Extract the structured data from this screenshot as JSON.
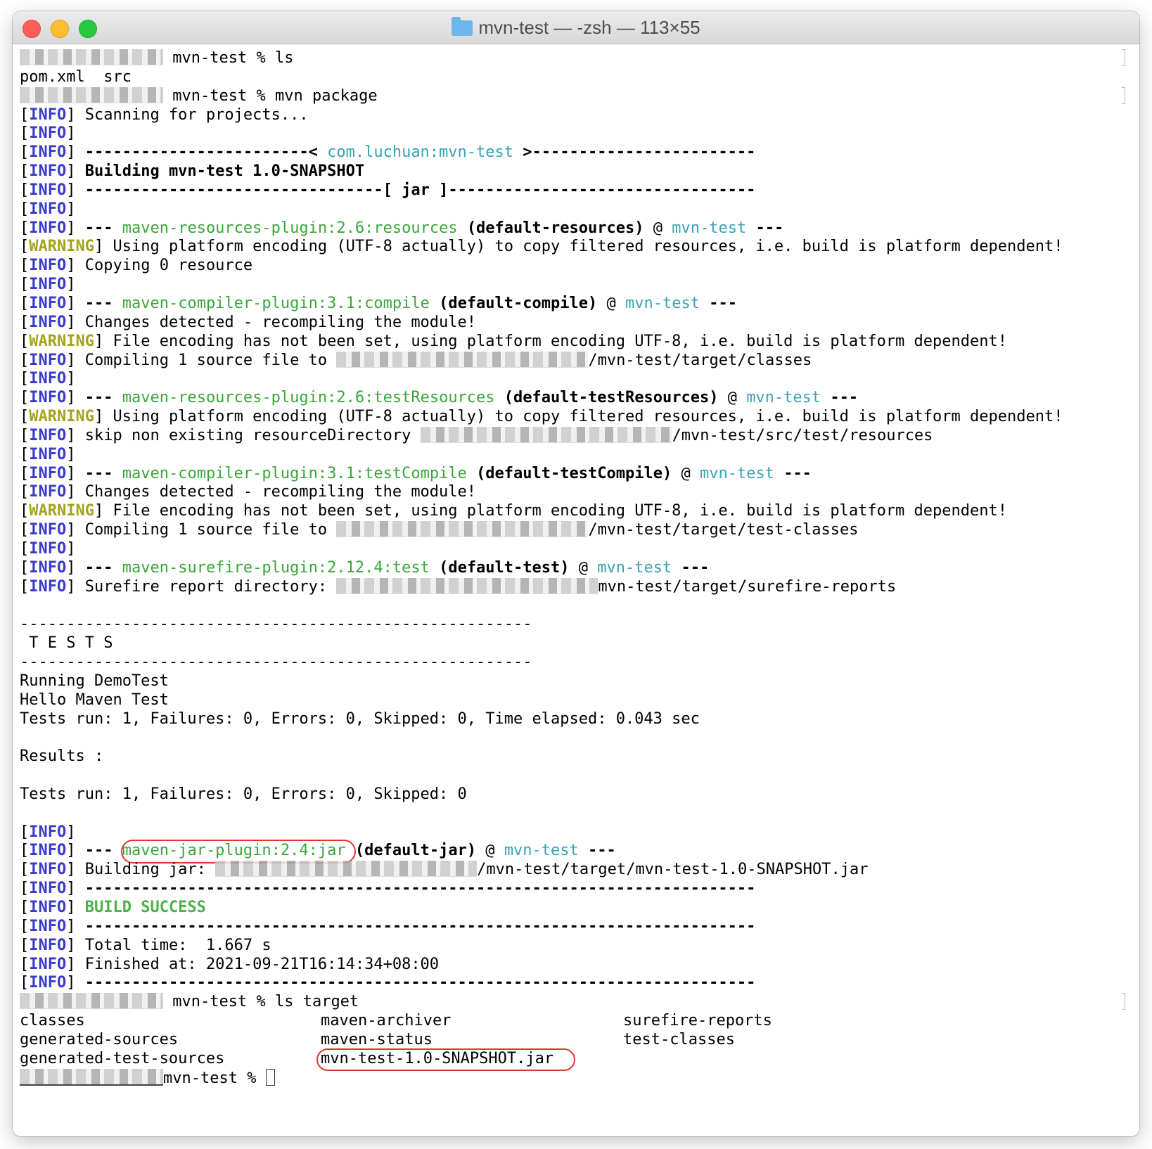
{
  "window": {
    "title": "mvn-test — -zsh — 113×55"
  },
  "prompt": {
    "dir": "mvn-test",
    "symbol": "%"
  },
  "commands": [
    "ls",
    "mvn package",
    "ls target"
  ],
  "ls_output": "pom.xml  src",
  "build": {
    "scanning": "Scanning for projects...",
    "project_id": "com.luchuan:mvn-test",
    "building": "Building mvn-test 1.0-SNAPSHOT",
    "packaging": "jar",
    "plugins": [
      {
        "name": "maven-resources-plugin:2.6:resources",
        "exec": "(default-resources)",
        "project": "mvn-test"
      },
      {
        "name": "maven-compiler-plugin:3.1:compile",
        "exec": "(default-compile)",
        "project": "mvn-test"
      },
      {
        "name": "maven-resources-plugin:2.6:testResources",
        "exec": "(default-testResources)",
        "project": "mvn-test"
      },
      {
        "name": "maven-compiler-plugin:3.1:testCompile",
        "exec": "(default-testCompile)",
        "project": "mvn-test"
      },
      {
        "name": "maven-surefire-plugin:2.12.4:test",
        "exec": "(default-test)",
        "project": "mvn-test"
      },
      {
        "name": "maven-jar-plugin:2.4:jar",
        "exec": "(default-jar)",
        "project": "mvn-test"
      }
    ],
    "warning_copy": "Using platform encoding (UTF-8 actually) to copy filtered resources, i.e. build is platform dependent!",
    "copying": "Copying 0 resource",
    "changes": "Changes detected - recompiling the module!",
    "warning_encoding": "File encoding has not been set, using platform encoding UTF-8, i.e. build is platform dependent!",
    "compiling_prefix": "Compiling 1 source file to ",
    "compile_target": "/mvn-test/target/classes",
    "skip_prefix": "skip non existing resourceDirectory ",
    "skip_target": "/mvn-test/src/test/resources",
    "test_compile_target": "/mvn-test/target/test-classes",
    "surefire_prefix": "Surefire report directory: ",
    "surefire_target": "mvn-test/target/surefire-reports",
    "jar_prefix": "Building jar: ",
    "jar_target": "/mvn-test/target/mvn-test-1.0-SNAPSHOT.jar",
    "result": "BUILD SUCCESS",
    "total_time": "Total time:  1.667 s",
    "finished": "Finished at: 2021-09-21T16:14:34+08:00"
  },
  "tests": {
    "header": " T E S T S",
    "running": "Running DemoTest",
    "output": "Hello Maven Test",
    "summary": "Tests run: 1, Failures: 0, Errors: 0, Skipped: 0, Time elapsed: 0.043 sec",
    "results_label": "Results :",
    "totals": "Tests run: 1, Failures: 0, Errors: 0, Skipped: 0"
  },
  "target_listing": [
    [
      "classes",
      "maven-archiver",
      "surefire-reports"
    ],
    [
      "generated-sources",
      "maven-status",
      "test-classes"
    ],
    [
      "generated-test-sources",
      "mvn-test-1.0-SNAPSHOT.jar",
      ""
    ]
  ],
  "labels": {
    "info": "INFO",
    "warning": "WARNING"
  },
  "colors": {
    "info": "#3a3acd",
    "warning": "#a3a31e",
    "plugin": "#3aa63a",
    "project": "#38a3b4",
    "success": "#4cb04c",
    "annotation": "#e0372f"
  }
}
